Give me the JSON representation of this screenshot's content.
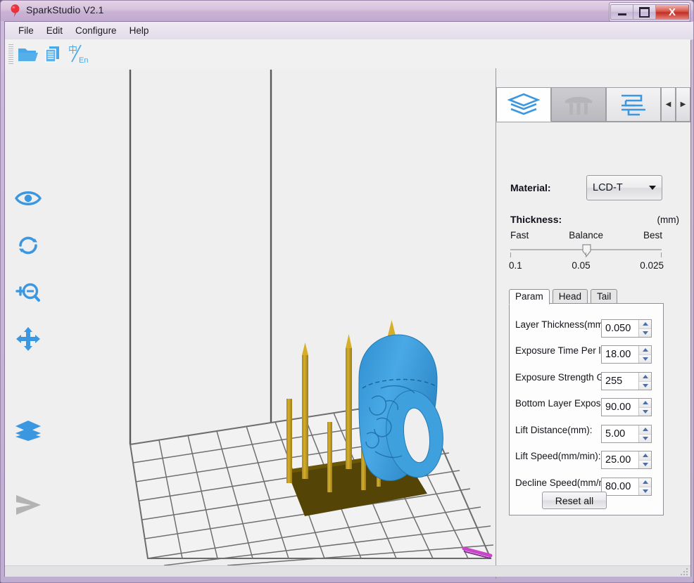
{
  "window": {
    "title": "SparkStudio V2.1",
    "icon": "balloon-pin-icon",
    "buttons": {
      "minimize": "–",
      "maximize": "□",
      "close": "X"
    }
  },
  "menubar": {
    "items": [
      "File",
      "Edit",
      "Configure",
      "Help"
    ]
  },
  "toolbar": {
    "buttons": [
      {
        "name": "open-file-icon",
        "label": "Open"
      },
      {
        "name": "copy-document-icon",
        "label": "Copy"
      },
      {
        "name": "language-toggle-icon",
        "label": "中/En"
      }
    ],
    "language_cn": "中",
    "language_en": "En"
  },
  "left_rail": {
    "items": [
      {
        "name": "eye-view-icon",
        "label": "View"
      },
      {
        "name": "rotate-icon",
        "label": "Rotate"
      },
      {
        "name": "zoom-icon",
        "label": "Zoom"
      },
      {
        "name": "move-icon",
        "label": "Move"
      },
      {
        "name": "layers-icon",
        "label": "Layers"
      },
      {
        "name": "play-slice-icon",
        "label": "Slice"
      }
    ]
  },
  "viewport": {
    "name": "3d-build-viewport",
    "model_color": "#3fa0de",
    "support_color": "#c9a227",
    "raft_color": "#544506",
    "grid_color": "#6b6b6b",
    "axis_color": "#cc44cc",
    "background": "#efeff0"
  },
  "panel": {
    "tabs": [
      {
        "name": "tab-layers",
        "icon": "layers-stack-icon",
        "active": true
      },
      {
        "name": "tab-supports",
        "icon": "support-pillars-icon",
        "active": false
      },
      {
        "name": "tab-slicing",
        "icon": "slice-settings-icon",
        "active": false
      }
    ],
    "scroll_left": "◀",
    "scroll_right": "▶",
    "material": {
      "label": "Material:",
      "value": "LCD-T"
    },
    "thickness": {
      "label": "Thickness:",
      "unit": "(mm)",
      "marks": [
        "Fast",
        "Balance",
        "Best"
      ],
      "values": [
        "0.1",
        "0.05",
        "0.025"
      ],
      "selected_index": 1
    },
    "param_tabs": [
      {
        "label": "Param",
        "active": true
      },
      {
        "label": "Head",
        "active": false
      },
      {
        "label": "Tail",
        "active": false
      }
    ],
    "params": [
      {
        "label": "Layer Thickness(mm):",
        "value": "0.050",
        "name": "layer-thickness"
      },
      {
        "label": "Exposure Time Per layer(s):",
        "value": "18.00",
        "name": "exposure-time-per-layer"
      },
      {
        "label": "Exposure Strength Grade(bit):",
        "value": "255",
        "name": "exposure-strength-grade"
      },
      {
        "label": "Bottom Layer Exposure Time(s",
        "value": "90.00",
        "name": "bottom-layer-exposure-time"
      },
      {
        "label": "Lift Distance(mm):",
        "value": "5.00",
        "name": "lift-distance"
      },
      {
        "label": "Lift Speed(mm/min):",
        "value": "25.00",
        "name": "lift-speed"
      },
      {
        "label": "Decline Speed(mm/min):",
        "value": "80.00",
        "name": "decline-speed"
      }
    ],
    "reset_label": "Reset all"
  }
}
